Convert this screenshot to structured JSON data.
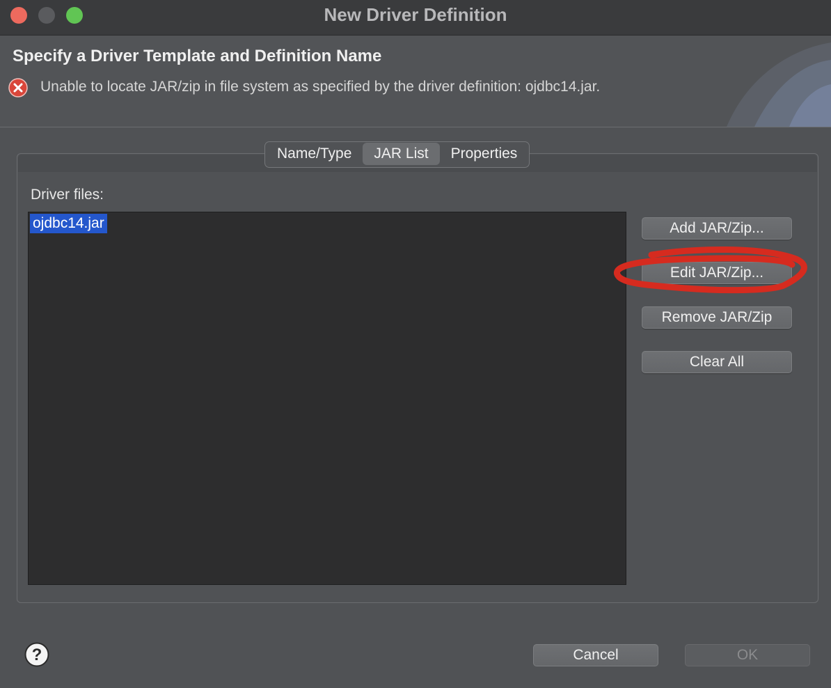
{
  "window": {
    "title": "New Driver Definition"
  },
  "header": {
    "title": "Specify a Driver Template and Definition Name",
    "error_icon": "error-circle-icon",
    "message": "Unable to locate JAR/zip in file system as specified by the driver definition: ojdbc14.jar."
  },
  "tabs": [
    {
      "label": "Name/Type",
      "active": false
    },
    {
      "label": "JAR List",
      "active": true
    },
    {
      "label": "Properties",
      "active": false
    }
  ],
  "jar_list": {
    "label": "Driver files:",
    "files": [
      "ojdbc14.jar"
    ],
    "selected": "ojdbc14.jar"
  },
  "buttons": {
    "add": "Add JAR/Zip...",
    "edit": "Edit JAR/Zip...",
    "remove": "Remove JAR/Zip",
    "clear": "Clear All"
  },
  "footer": {
    "help_icon": "help-icon",
    "cancel": "Cancel",
    "ok": "OK"
  },
  "colors": {
    "selection": "#2457cc",
    "annotation": "#d62b1f",
    "close": "#ed6a5e",
    "maximize": "#61c554"
  }
}
